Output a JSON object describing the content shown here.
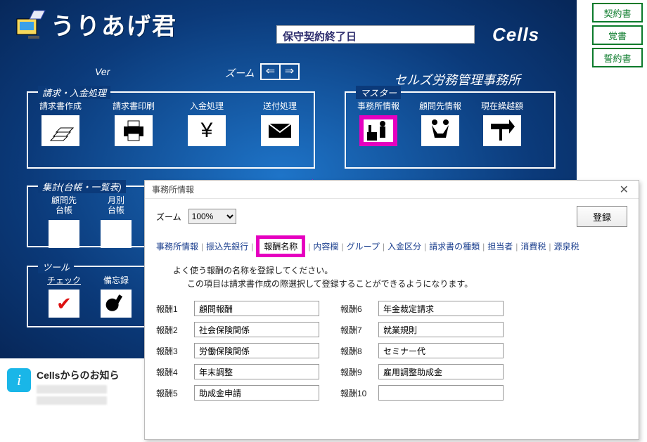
{
  "header": {
    "app_name": "うりあげ君",
    "contract_end_label": "保守契約終了日",
    "brand": "Cells",
    "ver_label": "Ver",
    "zoom_label": "ズーム",
    "office_name": "セルズ労務管理事務所"
  },
  "side_buttons": [
    "契約書",
    "覚書",
    "誓約書"
  ],
  "groups": {
    "billing": {
      "title": "請求・入金処理",
      "items": [
        {
          "label": "請求書作成",
          "icon": "paper-stack-icon"
        },
        {
          "label": "請求書印刷",
          "icon": "printer-icon"
        },
        {
          "label": "入金処理",
          "icon": "yen-icon"
        },
        {
          "label": "送付処理",
          "icon": "envelope-icon"
        }
      ]
    },
    "master": {
      "title": "マスター",
      "items": [
        {
          "label": "事務所情報",
          "icon": "office-icon",
          "highlight": true
        },
        {
          "label": "顧問先情報",
          "icon": "handshake-icon"
        },
        {
          "label": "現在繰越額",
          "icon": "carryover-icon"
        }
      ]
    },
    "totals": {
      "title": "集計(台帳・一覧表)",
      "items": [
        {
          "label": "顧問先\n台帳",
          "icon": "ledger-icon"
        },
        {
          "label": "月別\n台帳",
          "icon": "monthly-icon"
        }
      ]
    },
    "tools": {
      "title": "ツール",
      "items": [
        {
          "label": "チェック",
          "icon": "check-icon"
        },
        {
          "label": "備忘録",
          "icon": "memo-icon"
        }
      ]
    }
  },
  "info_panel": {
    "title": "Cellsからのお知ら"
  },
  "dialog": {
    "title": "事務所情報",
    "zoom_label": "ズーム",
    "zoom_value": "100%",
    "register": "登録",
    "tabs": [
      "事務所情報",
      "振込先銀行",
      "報酬名称",
      "内容欄",
      "グループ",
      "入金区分",
      "請求書の種類",
      "担当者",
      "消費税",
      "源泉税"
    ],
    "active_tab": 2,
    "msg1": "よく使う報酬の名称を登録してください。",
    "msg2": "この項目は請求書作成の際選択して登録することができるようになります。",
    "rows": [
      {
        "label": "報酬1",
        "value": "顧問報酬"
      },
      {
        "label": "報酬2",
        "value": "社会保険関係"
      },
      {
        "label": "報酬3",
        "value": "労働保険関係"
      },
      {
        "label": "報酬4",
        "value": "年末調整"
      },
      {
        "label": "報酬5",
        "value": "助成金申請"
      },
      {
        "label": "報酬6",
        "value": "年金裁定請求"
      },
      {
        "label": "報酬7",
        "value": "就業規則"
      },
      {
        "label": "報酬8",
        "value": "セミナー代"
      },
      {
        "label": "報酬9",
        "value": "雇用調整助成金"
      },
      {
        "label": "報酬10",
        "value": ""
      }
    ]
  }
}
